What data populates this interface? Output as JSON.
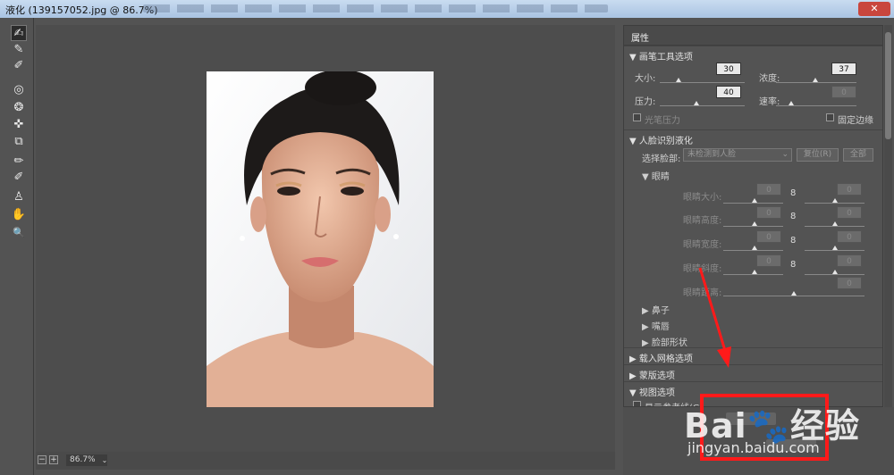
{
  "window": {
    "title": "液化 (139157052.jpg @ 86.7%)",
    "close_glyph": "✕"
  },
  "tools": [
    {
      "name": "forward-warp-tool-icon",
      "glyph": "✍",
      "active": true
    },
    {
      "name": "reconstruct-tool-icon",
      "glyph": "✎"
    },
    {
      "name": "smooth-tool-icon",
      "glyph": "✐"
    },
    {
      "name": "twirl-tool-icon",
      "glyph": "◎"
    },
    {
      "name": "pucker-tool-icon",
      "glyph": "❂"
    },
    {
      "name": "bloat-tool-icon",
      "glyph": "✜"
    },
    {
      "name": "push-left-tool-icon",
      "glyph": "⧉"
    },
    {
      "name": "freeze-mask-tool-icon",
      "glyph": "✏"
    },
    {
      "name": "thaw-mask-tool-icon",
      "glyph": "✐"
    },
    {
      "name": "face-tool-icon",
      "glyph": "♙"
    },
    {
      "name": "hand-tool-icon",
      "glyph": "✋"
    },
    {
      "name": "zoom-tool-icon",
      "glyph": "🔍"
    }
  ],
  "status": {
    "zoom_out": "−",
    "zoom_in": "+",
    "zoom_value": "86.7%",
    "zoom_dropdown": "⌄"
  },
  "props": {
    "title": "属性",
    "brush_section": "▼ 画笔工具选项",
    "size_label": "大小:",
    "size_value": "30",
    "density_label": "浓度:",
    "density_value": "37",
    "pressure_label": "压力:",
    "pressure_value": "40",
    "rate_label": "速率:",
    "rate_value": "0",
    "stylus_label": "光笔压力",
    "pin_edges_label": "固定边缘",
    "face_section": "▼ 人脸识别液化",
    "select_face_label": "选择脸部:",
    "select_face_value": "未检测到人脸",
    "reset_button": "复位(R)",
    "all_button": "全部",
    "eyes_section": "▼ 眼睛",
    "eye_size_label": "眼睛大小:",
    "eye_height_label": "眼睛高度:",
    "eye_width_label": "眼睛宽度:",
    "eye_tilt_label": "眼睛斜度:",
    "eye_distance_label": "眼睛距离:",
    "eye_zero": "0",
    "link_glyph": "8",
    "nose_section": "▶ 鼻子",
    "mouth_section": "▶ 嘴唇",
    "face_shape_section": "▶ 脸部形状",
    "load_mesh_section": "▶ 载入网格选项",
    "mask_section": "▶ 蒙版选项",
    "view_section": "▼ 视图选项",
    "show_guides_label": "显示参考线(G)"
  },
  "watermark": {
    "logo": "Bai🐾经验",
    "site": "jingyan.baidu.com"
  },
  "colors": {
    "annotation_red": "#ff1a1a",
    "panel_bg": "#535353"
  }
}
